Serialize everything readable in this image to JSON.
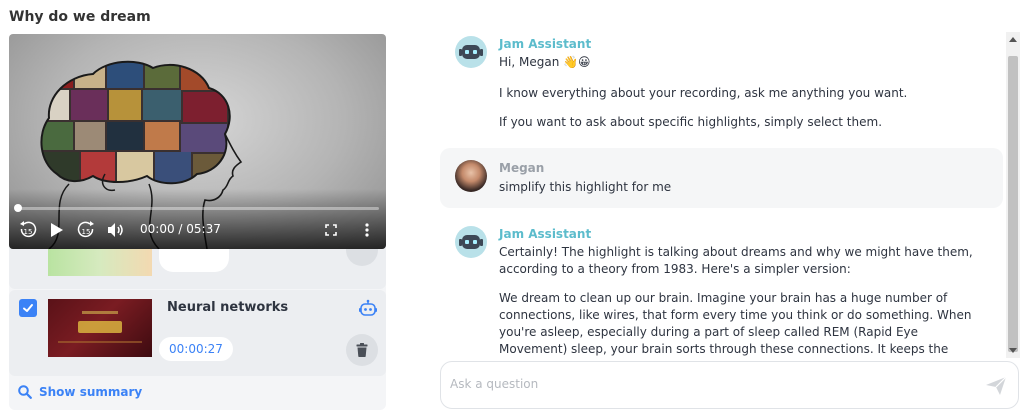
{
  "page": {
    "title": "Why do we dream"
  },
  "video": {
    "time": "00:00 / 05:37",
    "progress_fraction": 0.0
  },
  "highlights": [
    {
      "title": "Neural networks",
      "time": "00:00:27",
      "checked": true
    }
  ],
  "actions": {
    "show_summary": "Show summary"
  },
  "chat": {
    "messages": [
      {
        "sender": "Jam Assistant",
        "role": "assistant",
        "paragraphs": [
          "Hi, Megan 👋😀",
          "I know everything about your recording, ask me anything you want.",
          "If you want to ask about specific highlights, simply select them."
        ]
      },
      {
        "sender": "Megan",
        "role": "user",
        "paragraphs": [
          "simplify this highlight for me"
        ]
      },
      {
        "sender": "Jam Assistant",
        "role": "assistant",
        "paragraphs": [
          "Certainly! The highlight is talking about dreams and why we might have them, according to a theory from 1983. Here's a simpler version:",
          "We dream to clean up our brain. Imagine your brain has a huge number of connections, like wires, that form every time you think or do something. When you're asleep, especially during a part of sleep called REM (Rapid Eye Movement) sleep, your brain sorts through these connections. It keeps the important ones and gets rid of the"
        ]
      }
    ],
    "input_placeholder": "Ask a question"
  },
  "colors": {
    "accent": "#3b82f6",
    "assistant_name": "#5cbccc",
    "user_name": "#9aa0a8"
  },
  "icons": {
    "rewind": "rewind-15-icon",
    "play": "play-icon",
    "forward": "forward-15-icon",
    "volume": "volume-icon",
    "fullscreen": "fullscreen-icon",
    "more": "more-vertical-icon",
    "robot": "robot-icon",
    "trash": "trash-icon",
    "search": "search-icon",
    "send": "send-icon",
    "check": "check-icon"
  },
  "control_labels": {
    "skip_seconds": "15"
  }
}
